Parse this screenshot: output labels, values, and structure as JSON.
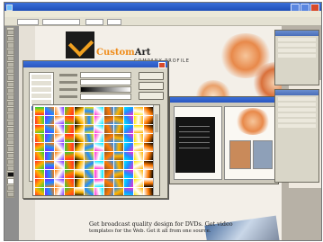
{
  "window": {
    "title": ""
  },
  "menu": [
    "",
    "",
    "",
    "",
    "",
    "",
    "",
    "",
    "",
    ""
  ],
  "document": {
    "brand_first": "Custom",
    "brand_second": "Art",
    "company_profile": "COMPANY PROFILE",
    "bottom_line1": "Get broadcast quality design for DVDs. Get video",
    "bottom_line2": "templates for the Web. Get it all from one source."
  },
  "gradient_dialog": {
    "title": "",
    "list_items": [
      "",
      "",
      "",
      "",
      "",
      "",
      "",
      "",
      "",
      "",
      ""
    ],
    "field_labels": [
      "",
      "",
      "",
      ""
    ],
    "buttons": [
      "",
      "",
      ""
    ]
  },
  "colors": {
    "xp_blue": "#2a56c0",
    "brand_orange": "#ef8c1a",
    "chrome_gray": "#d9d6c8"
  },
  "icons": [
    "app-icon",
    "minimize-icon",
    "maximize-icon",
    "close-icon",
    "logo-icon"
  ]
}
